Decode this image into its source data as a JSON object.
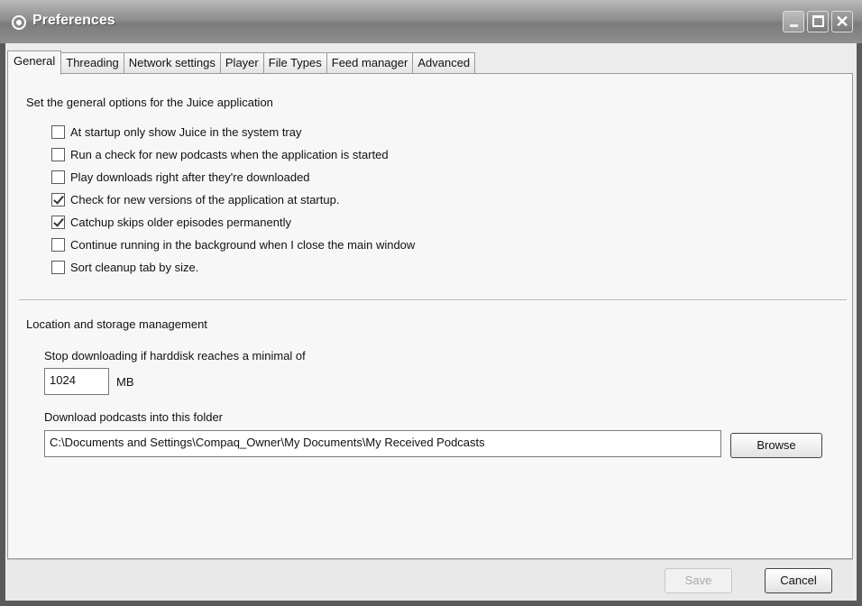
{
  "window": {
    "title": "Preferences"
  },
  "tabs": [
    {
      "label": "General",
      "active": true
    },
    {
      "label": "Threading"
    },
    {
      "label": "Network settings"
    },
    {
      "label": "Player"
    },
    {
      "label": "File Types"
    },
    {
      "label": "Feed manager"
    },
    {
      "label": "Advanced"
    }
  ],
  "general": {
    "heading": "Set the general options for the Juice application",
    "options": [
      {
        "label": "At startup only show Juice in the system tray",
        "checked": false
      },
      {
        "label": "Run a check for new podcasts when the application is started",
        "checked": false
      },
      {
        "label": "Play downloads right after they're downloaded",
        "checked": false
      },
      {
        "label": "Check for new versions of the application at startup.",
        "checked": true
      },
      {
        "label": "Catchup skips older episodes permanently",
        "checked": true
      },
      {
        "label": "Continue running in the background when I close the main window",
        "checked": false
      },
      {
        "label": "Sort cleanup tab by size.",
        "checked": false
      }
    ]
  },
  "storage": {
    "heading": "Location and storage management",
    "min_disk_label": "Stop downloading if harddisk reaches a minimal of",
    "min_disk_value": "1024",
    "min_disk_unit": "MB",
    "folder_label": "Download podcasts into this folder",
    "folder_value": "C:\\Documents and Settings\\Compaq_Owner\\My Documents\\My Received Podcasts",
    "browse_label": "Browse"
  },
  "footer": {
    "save_label": "Save",
    "cancel_label": "Cancel"
  },
  "colors": {
    "titlebar": "#8e8e8e",
    "panel": "#f7f7f7"
  }
}
